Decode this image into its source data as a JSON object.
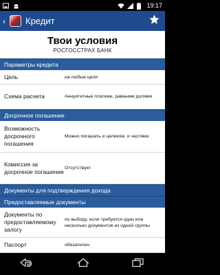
{
  "status_bar": {
    "time": "19:17"
  },
  "action_bar": {
    "title": "Кредит"
  },
  "page": {
    "title": "Твои условия",
    "subtitle": "РОСГОССТРАХ БАНК"
  },
  "sections": [
    {
      "header": "Параметры кредита",
      "rows": [
        {
          "label": "Цель",
          "value": "на любые цели"
        },
        {
          "label": "Схема расчета",
          "value": "Аннуитетные платежи, равными долями"
        }
      ]
    },
    {
      "header": "Досрочное погашение",
      "rows": [
        {
          "label": "Возможность досрочного погашения",
          "value": "Можно погашать и целиком, и частями"
        },
        {
          "label": "Комиссия за досрочное погашение",
          "value": "Отсутствует"
        }
      ]
    },
    {
      "header": "Документы для подтверждения дохода",
      "rows": []
    },
    {
      "header": "Предоставляемые документы",
      "rows": [
        {
          "label": "Документы по предоставляемому залогу",
          "value": "по выбору, если требуется один или несколько документов из одной группы"
        },
        {
          "label": "Паспорт",
          "value": "обязателен"
        }
      ]
    }
  ],
  "icons": {
    "status_left": [
      "image-icon",
      "android-icon"
    ],
    "status_right": [
      "wifi-icon",
      "signal-icon",
      "battery-icon"
    ],
    "action": [
      "back-arrow-icon",
      "app-logo-icon",
      "star-icon"
    ],
    "nav": [
      "nav-back-icon",
      "nav-home-icon",
      "nav-recents-icon"
    ]
  },
  "colors": {
    "action_bar": "#1f4b8e",
    "section_header": "#2a5c9e"
  }
}
